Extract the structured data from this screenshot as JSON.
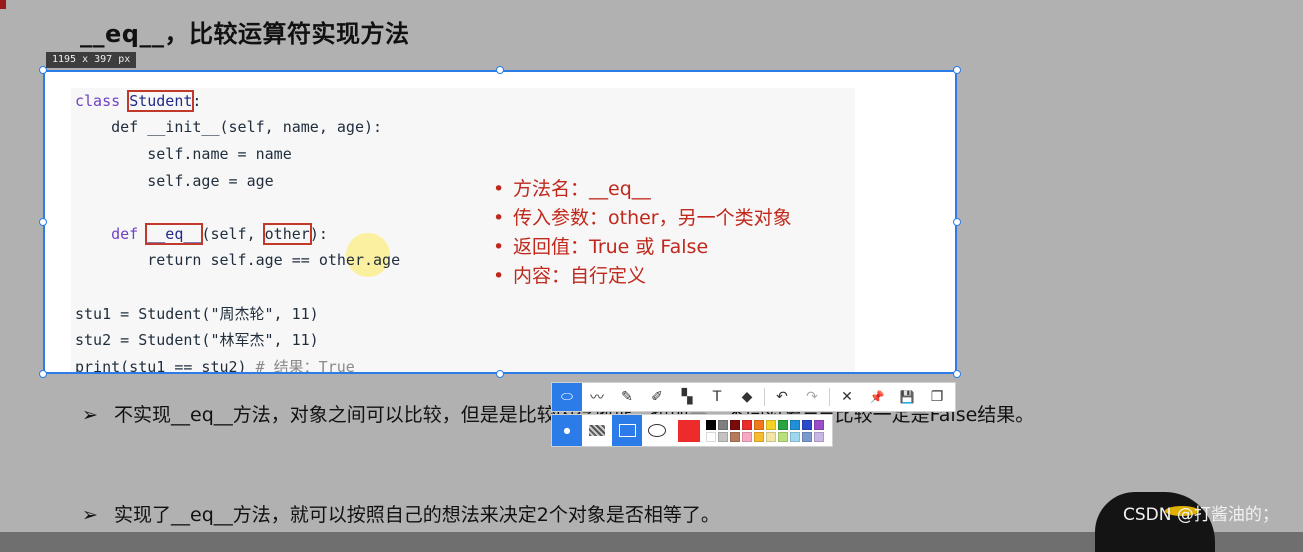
{
  "slide": {
    "title": "__eq__，比较运算符实现方法",
    "point1": "不实现__eq__方法，对象之间可以比较，但是是比较内存地址，也即是：不同对象==比较一定是False结果。",
    "point2": "实现了__eq__方法，就可以按照自己的想法来决定2个对象是否相等了。",
    "bullet_glyph": "➢"
  },
  "capture": {
    "size_label": "1195 x 397  px"
  },
  "code": {
    "line1_kw": "class ",
    "line1_name": "Student",
    "line1_end": ":",
    "line2": "    def __init__(self, name, age):",
    "line3": "        self.name = name",
    "line4": "        self.age = age",
    "line6_def": "    def ",
    "line6_eq": "__eq__",
    "line6_mid": "(self, ",
    "line6_other": "other",
    "line6_end": "):",
    "line7": "        return self.age == other.age",
    "line9": "stu1 = Student(\"周杰轮\", 11)",
    "line10": "stu2 = Student(\"林军杰\", 11)",
    "line11_code": "print(stu1 == stu2) ",
    "line11_comment": "# 结果：True"
  },
  "notes": [
    "方法名：__eq__",
    "传入参数：other，另一个类对象",
    "返回值：True 或 False",
    "内容：自行定义"
  ],
  "note_bullet": "•",
  "toolbar": {
    "tools": [
      {
        "name": "select-shape",
        "glyph": "⬭"
      },
      {
        "name": "line",
        "glyph": "〰"
      },
      {
        "name": "pen",
        "glyph": "✎"
      },
      {
        "name": "marker",
        "glyph": "✐"
      },
      {
        "name": "mosaic",
        "glyph": "▚"
      },
      {
        "name": "text",
        "glyph": "T"
      },
      {
        "name": "eraser",
        "glyph": "◆"
      },
      {
        "name": "undo",
        "glyph": "↶"
      },
      {
        "name": "redo",
        "glyph": "↷"
      },
      {
        "name": "close",
        "glyph": "✕"
      },
      {
        "name": "pin",
        "glyph": "📌"
      },
      {
        "name": "save",
        "glyph": "💾"
      },
      {
        "name": "copy",
        "glyph": "❐"
      }
    ],
    "current_color": "#ee2b2b",
    "palette": [
      "#000000",
      "#7f7f7f",
      "#7a0b0b",
      "#ee2b2b",
      "#f07a1a",
      "#f5d322",
      "#2aa342",
      "#1e90d8",
      "#2b4bc9",
      "#9b4dc9",
      "#ffffff",
      "#c3c3c3",
      "#b57b5a",
      "#f7a8c3",
      "#f7bd2e",
      "#f3e5a3",
      "#b9e07a",
      "#9ed8ee",
      "#7b9bd0",
      "#c8b6e6"
    ]
  },
  "watermark": "CSDN @打酱油的；"
}
